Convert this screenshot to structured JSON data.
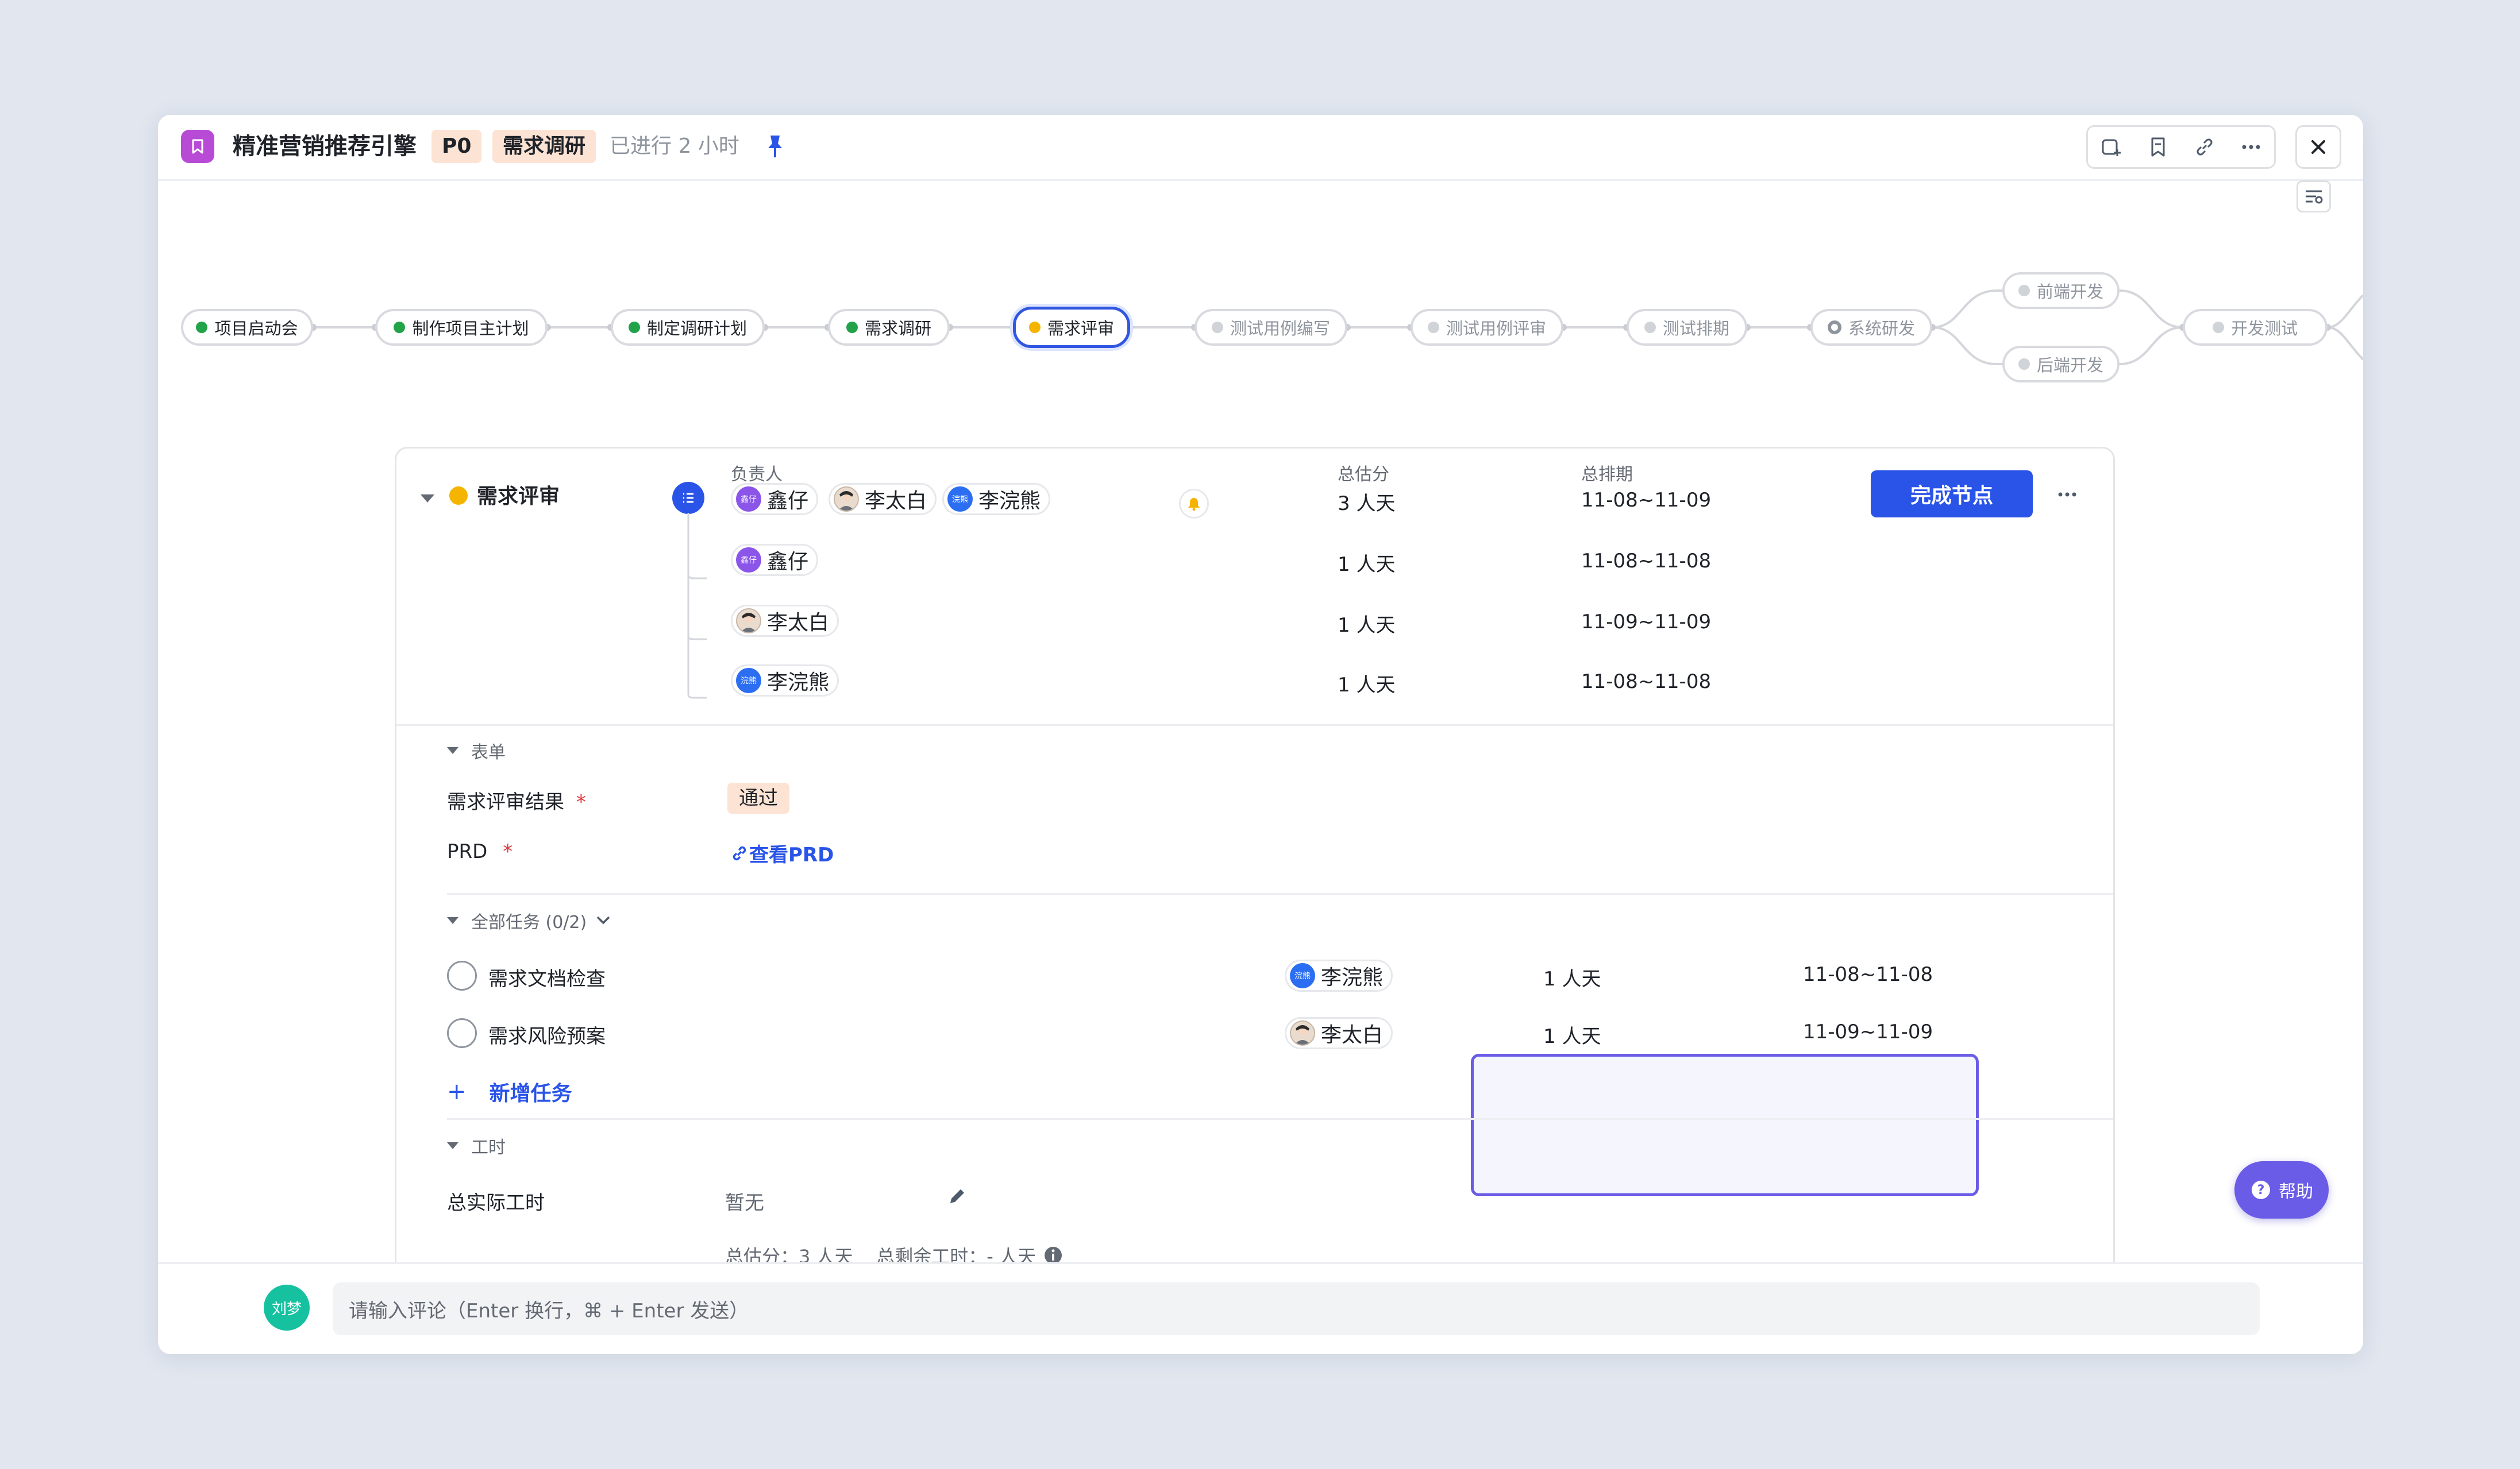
{
  "header": {
    "title": "精准营销推荐引擎",
    "priority": "P0",
    "stage": "需求调研",
    "elapsed": "已进行 2 小时"
  },
  "flow": {
    "nodes": [
      {
        "label": "项目启动会",
        "status": "done"
      },
      {
        "label": "制作项目主计划",
        "status": "done"
      },
      {
        "label": "制定调研计划",
        "status": "done"
      },
      {
        "label": "需求调研",
        "status": "done"
      },
      {
        "label": "需求评审",
        "status": "current"
      },
      {
        "label": "测试用例编写",
        "status": "todo"
      },
      {
        "label": "测试用例评审",
        "status": "todo"
      },
      {
        "label": "测试排期",
        "status": "todo"
      },
      {
        "label": "系统研发",
        "status": "in-progress"
      },
      {
        "label": "前端开发",
        "status": "todo"
      },
      {
        "label": "后端开发",
        "status": "todo"
      },
      {
        "label": "开发测试",
        "status": "todo"
      }
    ]
  },
  "node_detail": {
    "name": "需求评审",
    "col_owner": "负责人",
    "col_estimate": "总估分",
    "col_schedule": "总排期",
    "summary": {
      "owners": [
        {
          "name": "鑫仔",
          "avatar_text": "鑫仔"
        },
        {
          "name": "李太白",
          "avatar_text": ""
        },
        {
          "name": "李浣熊",
          "avatar_text": "浣熊"
        }
      ],
      "estimate": "3 人天",
      "schedule": "11-08~11-09"
    },
    "rows": [
      {
        "owner": "鑫仔",
        "avatar_text": "鑫仔",
        "estimate": "1 人天",
        "schedule": "11-08~11-08"
      },
      {
        "owner": "李太白",
        "avatar_text": "",
        "estimate": "1 人天",
        "schedule": "11-09~11-09"
      },
      {
        "owner": "李浣熊",
        "avatar_text": "浣熊",
        "estimate": "1 人天",
        "schedule": "11-08~11-08"
      }
    ],
    "complete_label": "完成节点"
  },
  "form": {
    "section": "表单",
    "review_label": "需求评审结果",
    "review_value": "通过",
    "prd_label": "PRD",
    "prd_link": "查看PRD",
    "required_mark": "*"
  },
  "tasks": {
    "section": "全部任务 (0/2)",
    "items": [
      {
        "name": "需求文档检查",
        "owner": "李浣熊",
        "avatar_text": "浣熊",
        "estimate": "1 人天",
        "schedule": "11-08~11-08"
      },
      {
        "name": "需求风险预案",
        "owner": "李太白",
        "avatar_text": "",
        "estimate": "1 人天",
        "schedule": "11-09~11-09"
      }
    ],
    "add_label": "新增任务",
    "plus": "+"
  },
  "worktime": {
    "section": "工时",
    "actual_label": "总实际工时",
    "actual_value": "暂无",
    "summary": "总估分：3 人天    总剩余工时：- 人天"
  },
  "footer": {
    "user_initials": "刘梦",
    "comment_placeholder": "请输入评论（Enter 换行，⌘ + Enter 发送）",
    "help_label": "帮助"
  },
  "colors": {
    "accent": "#2a54e8",
    "done": "#22a34a",
    "current": "#f5b400",
    "help": "#6a5ce6"
  }
}
